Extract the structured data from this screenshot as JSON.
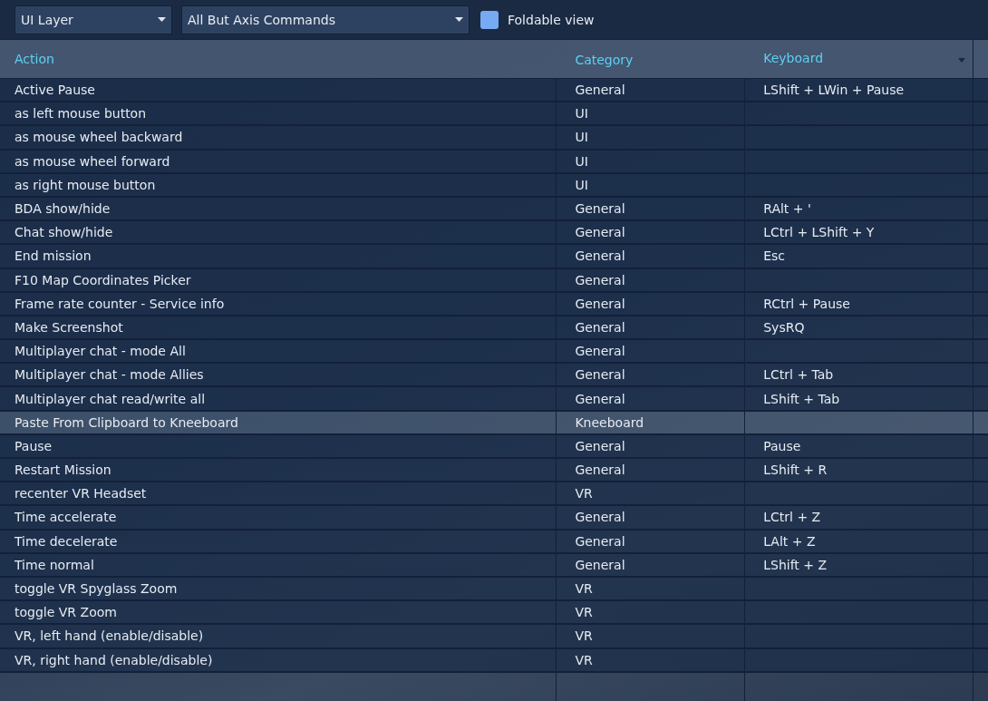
{
  "toolbar": {
    "layer_dropdown": {
      "value": "UI Layer"
    },
    "filter_dropdown": {
      "value": "All But Axis Commands"
    },
    "foldable_view": {
      "label": "Foldable view",
      "checked": false
    }
  },
  "table": {
    "columns": [
      {
        "label": "Action",
        "sorted": false
      },
      {
        "label": "Category",
        "sorted": false
      },
      {
        "label": "Keyboard",
        "sorted": true
      }
    ],
    "rows": [
      {
        "cells": [
          "Active Pause",
          "General",
          "LShift + LWin + Pause"
        ],
        "selected": false
      },
      {
        "cells": [
          "as left mouse button",
          "UI",
          ""
        ],
        "selected": false
      },
      {
        "cells": [
          "as mouse wheel backward",
          "UI",
          ""
        ],
        "selected": false
      },
      {
        "cells": [
          "as mouse wheel forward",
          "UI",
          ""
        ],
        "selected": false
      },
      {
        "cells": [
          "as right mouse button",
          "UI",
          ""
        ],
        "selected": false
      },
      {
        "cells": [
          "BDA show/hide",
          "General",
          "RAlt + '"
        ],
        "selected": false
      },
      {
        "cells": [
          "Chat show/hide",
          "General",
          "LCtrl + LShift + Y"
        ],
        "selected": false
      },
      {
        "cells": [
          "End mission",
          "General",
          "Esc"
        ],
        "selected": false
      },
      {
        "cells": [
          "F10 Map Coordinates Picker",
          "General",
          ""
        ],
        "selected": false
      },
      {
        "cells": [
          "Frame rate counter - Service info",
          "General",
          "RCtrl + Pause"
        ],
        "selected": false
      },
      {
        "cells": [
          "Make Screenshot",
          "General",
          "SysRQ"
        ],
        "selected": false
      },
      {
        "cells": [
          "Multiplayer chat - mode All",
          "General",
          ""
        ],
        "selected": false
      },
      {
        "cells": [
          "Multiplayer chat - mode Allies",
          "General",
          "LCtrl + Tab"
        ],
        "selected": false
      },
      {
        "cells": [
          "Multiplayer chat read/write all",
          "General",
          "LShift + Tab"
        ],
        "selected": false
      },
      {
        "cells": [
          "Paste From Clipboard to Kneeboard",
          "Kneeboard",
          ""
        ],
        "selected": true
      },
      {
        "cells": [
          "Pause",
          "General",
          "Pause"
        ],
        "selected": false
      },
      {
        "cells": [
          "Restart Mission",
          "General",
          "LShift + R"
        ],
        "selected": false
      },
      {
        "cells": [
          "recenter VR Headset",
          "VR",
          ""
        ],
        "selected": false
      },
      {
        "cells": [
          "Time accelerate",
          "General",
          "LCtrl + Z"
        ],
        "selected": false
      },
      {
        "cells": [
          "Time decelerate",
          "General",
          "LAlt + Z"
        ],
        "selected": false
      },
      {
        "cells": [
          "Time normal",
          "General",
          "LShift + Z"
        ],
        "selected": false
      },
      {
        "cells": [
          "toggle VR Spyglass Zoom",
          "VR",
          ""
        ],
        "selected": false
      },
      {
        "cells": [
          "toggle VR Zoom",
          "VR",
          ""
        ],
        "selected": false
      },
      {
        "cells": [
          "VR, left hand (enable/disable)",
          "VR",
          ""
        ],
        "selected": false
      },
      {
        "cells": [
          "VR, right hand (enable/disable)",
          "VR",
          ""
        ],
        "selected": false
      }
    ]
  }
}
